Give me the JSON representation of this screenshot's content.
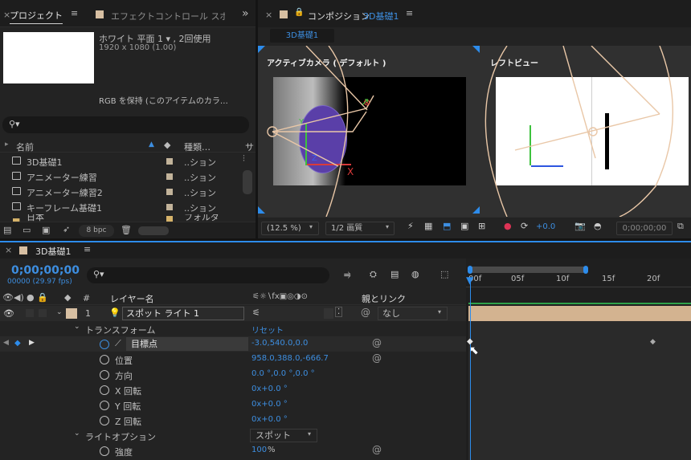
{
  "project": {
    "tab": "プロジェクト",
    "menu": "≡",
    "effect_tab": "エフェクトコントロール スポット",
    "expand": "»",
    "info_line1": "ホワイト 平面 1 ▾ , 2回使用",
    "info_line2": "1920 x 1080 (1.00)",
    "info_line3": "RGB を保持 (このアイテムのカラ…",
    "search_placeholder": "",
    "col_name": "名前",
    "col_type": "種類…",
    "col_extra": "サ",
    "items": [
      {
        "name": "3D基礎1",
        "type": "..ション"
      },
      {
        "name": "アニメーター練習",
        "type": "..ション"
      },
      {
        "name": "アニメーター練習2",
        "type": "..ション"
      },
      {
        "name": "キーフレーム基礎1",
        "type": "..ション"
      },
      {
        "name": "日本",
        "type": "フォルダ"
      }
    ],
    "bpc": "8 bpc"
  },
  "comp": {
    "title_prefix": "コンポジション",
    "title_name": "3D基礎1",
    "menu": "≡",
    "chip": "3D基礎1",
    "view_active": "アクティブカメラ ( デフォルト )",
    "view_left": "レフトビュー",
    "zoom": "(12.5 %)",
    "quality": "1/2 画質",
    "exposure": "+0.0",
    "timecode": "0;00;00;00",
    "axis_x": "X",
    "axis_y": "Y",
    "axis_z": "Z"
  },
  "timeline": {
    "tab": "3D基礎1",
    "menu": "≡",
    "timecode": "0;00;00;00",
    "frame_info": "00000 (29.97 fps)",
    "search_placeholder": "",
    "col_layer_name": "レイヤー名",
    "col_parent": "親とリンク",
    "col_num": "#",
    "ruler": [
      "00f",
      "05f",
      "10f",
      "15f",
      "20f"
    ],
    "layer": {
      "num": "1",
      "name": "スポット ライト 1",
      "parent": "なし"
    },
    "transform_label": "トランスフォーム",
    "reset": "リセット",
    "props": [
      {
        "name": "目標点",
        "value": "-3.0,540.0,0.0"
      },
      {
        "name": "位置",
        "value": "958.0,388.0,-666.7"
      },
      {
        "name": "方向",
        "value": "0.0 °,0.0 °,0.0 °"
      },
      {
        "name": "X 回転",
        "value": "0x+0.0 °"
      },
      {
        "name": "Y 回転",
        "value": "0x+0.0 °"
      },
      {
        "name": "Z 回転",
        "value": "0x+0.0 °"
      }
    ],
    "light_options": "ライトオプション",
    "light_type": "スポット",
    "intensity_label": "強度",
    "intensity_value": "100",
    "intensity_unit": "%"
  },
  "colors": {
    "accent": "#2d8ceb",
    "layer_bar": "#d3b390",
    "label_swatch": "#c2b39a"
  }
}
